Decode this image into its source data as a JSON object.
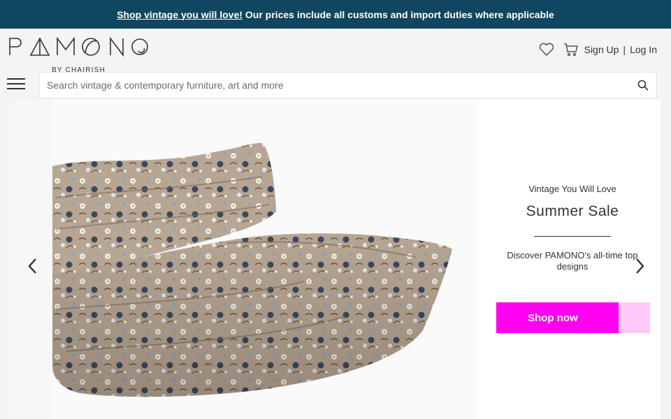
{
  "banner": {
    "link_text": "Shop vintage you will love!",
    "message": "Our prices include all customs and import duties where applicable",
    "background": "#10465f"
  },
  "header": {
    "logo_text": "PAMONO",
    "logo_sub": "BY CHAIRISH",
    "icons": [
      "heart-icon",
      "cart-icon"
    ],
    "sign_up": "Sign Up",
    "separator": "|",
    "log_in": "Log In"
  },
  "search": {
    "placeholder": "Search vintage & contemporary furniture, art and more",
    "value": ""
  },
  "hero": {
    "eyebrow": "Vintage You Will Love",
    "title": "Summer Sale",
    "description": "Discover PAMONO's all-time top designs",
    "cta_label": "Shop now",
    "cta_color": "#ff00f0",
    "product": "floral-sofa-image",
    "prev_icon": "chevron-left-icon",
    "next_icon": "chevron-right-icon"
  }
}
